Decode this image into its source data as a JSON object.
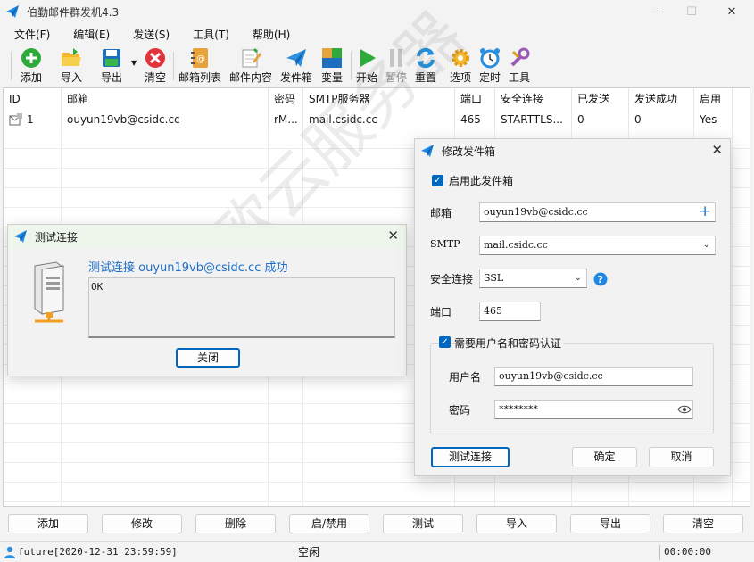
{
  "window": {
    "title": "伯勤邮件群发机4.3",
    "min": "—",
    "max": "☐",
    "close": "✕"
  },
  "menu": [
    "文件(F)",
    "编辑(E)",
    "发送(S)",
    "工具(T)",
    "帮助(H)"
  ],
  "toolbar": {
    "add": "添加",
    "import": "导入",
    "export": "导出",
    "clear": "清空",
    "mailbox_list": "邮箱列表",
    "mail_content": "邮件内容",
    "sender_box": "发件箱",
    "variables": "变量",
    "start": "开始",
    "pause": "暂停",
    "reset": "重置",
    "options": "选项",
    "timer": "定时",
    "tools": "工具"
  },
  "table": {
    "columns": [
      "ID",
      "邮箱",
      "密码",
      "SMTP服务器",
      "端口",
      "安全连接",
      "已发送",
      "发送成功",
      "启用"
    ],
    "rows": [
      {
        "id": "1",
        "email": "ouyun19vb@csidc.cc",
        "password": "rM...",
        "smtp": "mail.csidc.cc",
        "port": "465",
        "security": "STARTTLS...",
        "sent": "0",
        "success": "0",
        "enabled": "Yes"
      }
    ]
  },
  "bottom_buttons": [
    "添加",
    "修改",
    "删除",
    "启/禁用",
    "测试",
    "导入",
    "导出",
    "清空"
  ],
  "status": {
    "user": "future[2020-12-31 23:59:59]",
    "state": "空闲",
    "time": "00:00:00"
  },
  "test_dialog": {
    "title": "测试连接",
    "message": "测试连接 ouyun19vb@csidc.cc 成功",
    "output": "OK",
    "close_button": "关闭"
  },
  "mail_dialog": {
    "title": "修改发件箱",
    "enable_label": "启用此发件箱",
    "email_label": "邮箱",
    "email_value": "ouyun19vb@csidc.cc",
    "smtp_label": "SMTP",
    "smtp_value": "mail.csidc.cc",
    "security_label": "安全连接",
    "security_value": "SSL",
    "port_label": "端口",
    "port_value": "465",
    "auth_label": "需要用户名和密码认证",
    "username_label": "用户名",
    "username_value": "ouyun19vb@csidc.cc",
    "password_label": "密码",
    "password_value": "********",
    "test_button": "测试连接",
    "ok_button": "确定",
    "cancel_button": "取消"
  },
  "watermark": "欧云服务器",
  "colors": {
    "accent": "#0067c0",
    "link": "#1e6fc9"
  }
}
